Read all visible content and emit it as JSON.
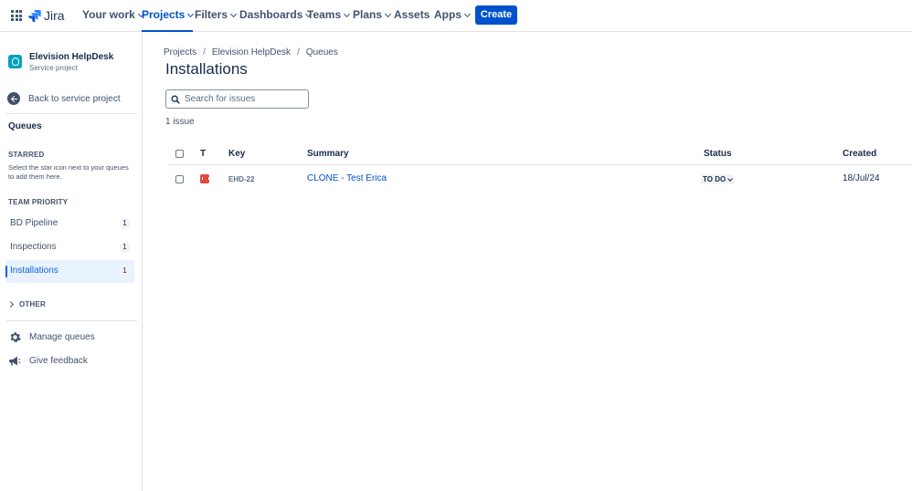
{
  "topnav": {
    "logo_text": "Jira",
    "items": [
      {
        "label": "Your work"
      },
      {
        "label": "Projects"
      },
      {
        "label": "Filters"
      },
      {
        "label": "Dashboards"
      },
      {
        "label": "Teams"
      },
      {
        "label": "Plans"
      },
      {
        "label": "Assets"
      },
      {
        "label": "Apps"
      }
    ],
    "active_item": "Projects",
    "create_label": "Create",
    "accent_color": "#0052cc"
  },
  "sidebar": {
    "project_name": "Elevision HelpDesk",
    "project_type": "Service project",
    "back_label": "Back to service project",
    "queues_title": "Queues",
    "starred_label": "STARRED",
    "starred_help": "Select the star icon next to your queues to add them here.",
    "team_priority_label": "TEAM PRIORITY",
    "queues": [
      {
        "label": "BD Pipeline",
        "count": "1"
      },
      {
        "label": "Inspections",
        "count": "1"
      },
      {
        "label": "Installations",
        "count": "1"
      }
    ],
    "active_queue": "Installations",
    "other_label": "OTHER",
    "manage_queues_label": "Manage queues",
    "give_feedback_label": "Give feedback"
  },
  "main": {
    "breadcrumb": [
      "Projects",
      "Elevision HelpDesk",
      "Queues"
    ],
    "breadcrumb_sep": "/",
    "title": "Installations",
    "search_placeholder": "Search for issues",
    "issue_count": "1 issue",
    "columns": {
      "type": "T",
      "key": "Key",
      "summary": "Summary",
      "status": "Status",
      "created": "Created"
    },
    "rows": [
      {
        "type_icon": "bug-icon",
        "key": "EHD-22",
        "summary": "CLONE - Test Erica",
        "status": "TO DO",
        "created": "18/Jul/24"
      }
    ]
  }
}
